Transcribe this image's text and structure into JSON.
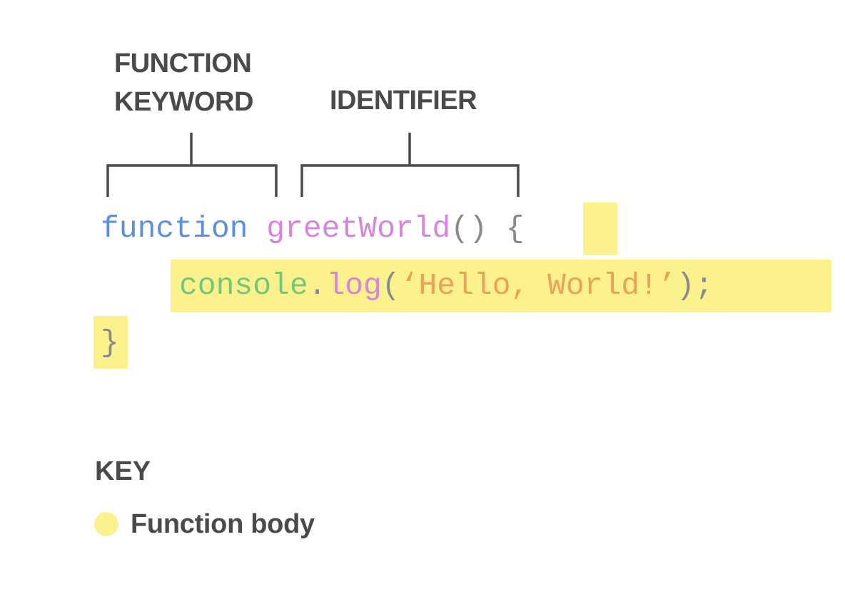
{
  "annotations": {
    "function_keyword": [
      "FUNCTION",
      "KEYWORD"
    ],
    "identifier": "IDENTIFIER"
  },
  "code": {
    "line1": {
      "keyword": "function",
      "name": "greetWorld",
      "parens": "()",
      "open_brace": "{"
    },
    "line2": {
      "object": "console",
      "dot": ".",
      "method": "log",
      "open_paren": "(",
      "string": "‘Hello, World!’",
      "close": ");"
    },
    "line3": {
      "close_brace": "}"
    }
  },
  "key": {
    "title": "KEY",
    "items": [
      {
        "label": "Function body",
        "color": "#fbf28e"
      }
    ]
  },
  "colors": {
    "keyword": "#5b8fe0",
    "identifier": "#d784dd",
    "punctuation": "#8a8a8a",
    "object": "#72c77a",
    "string": "#e9a15b",
    "highlight": "#fbf28e",
    "annotation_text": "#4a4a4a"
  }
}
